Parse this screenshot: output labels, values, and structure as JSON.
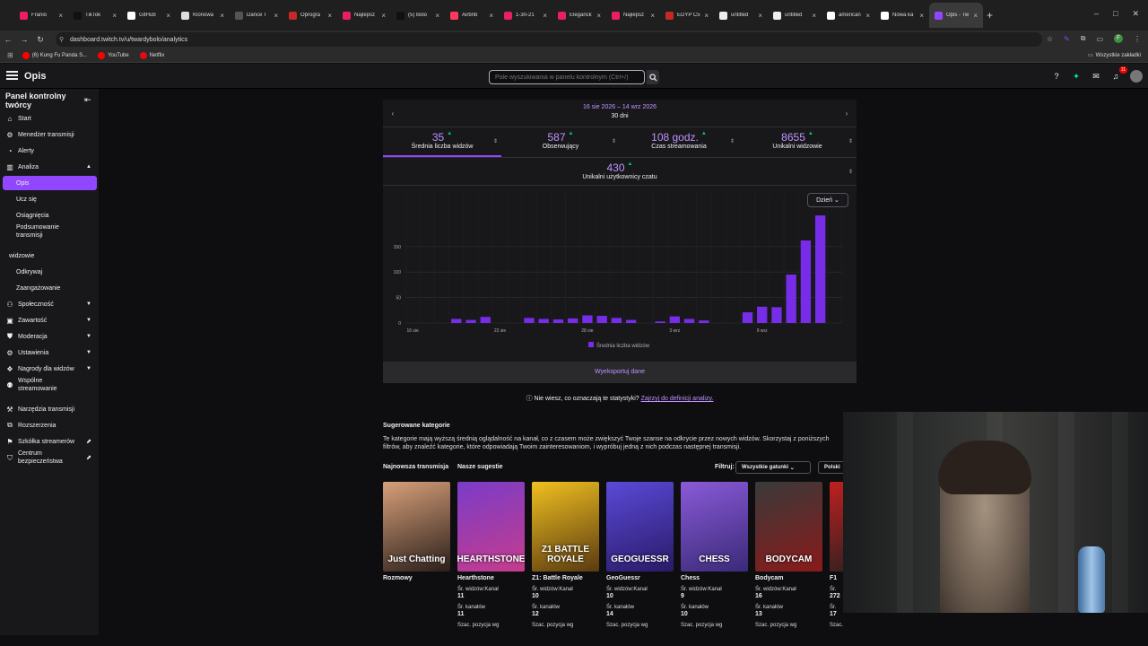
{
  "browser": {
    "tabs": [
      {
        "label": "Franio",
        "color": "#e91e63"
      },
      {
        "label": "TikTok",
        "color": "#111111"
      },
      {
        "label": "GitHub",
        "color": "#ffffff"
      },
      {
        "label": "Klonowa",
        "color": "#dddddd"
      },
      {
        "label": "Dance T",
        "color": "#555555"
      },
      {
        "label": "Oprogra",
        "color": "#c62828"
      },
      {
        "label": "Najlepsz",
        "color": "#e91e63"
      },
      {
        "label": "(5) Bolo",
        "color": "#111111"
      },
      {
        "label": "Airbnb",
        "color": "#ff385c"
      },
      {
        "label": "1-30-21",
        "color": "#e91e63"
      },
      {
        "label": "Eleganck",
        "color": "#e91e63"
      },
      {
        "label": "Najlepsz",
        "color": "#e91e63"
      },
      {
        "label": "EDYP C5",
        "color": "#c62828"
      },
      {
        "label": "untitled",
        "color": "#eeeeee"
      },
      {
        "label": "untitled",
        "color": "#eeeeee"
      },
      {
        "label": "american",
        "color": "#ffffff"
      },
      {
        "label": "Nowa ka",
        "color": "#ffffff"
      },
      {
        "label": "Opis - Tw",
        "color": "#9147ff",
        "active": true
      }
    ],
    "url": "dashboard.twitch.tv/u/twardybolo/analytics",
    "bookmarks": [
      {
        "label": "(6) Kung Fu Panda S...",
        "color": "#ff0000"
      },
      {
        "label": "YouTube",
        "color": "#ff0000"
      },
      {
        "label": "Netflix",
        "color": "#e50914"
      }
    ],
    "bookmarks_right": "Wszystkie zakładki",
    "profile_letter": "F"
  },
  "topnav": {
    "title": "Opis",
    "search_placeholder": "Pole wyszukiwania w panelu kontrolnym (Ctrl+/)",
    "notif_count": "11"
  },
  "sidebar": {
    "title": "Panel kontrolny twórcy",
    "items": [
      {
        "label": "Start",
        "icon": "⌂"
      },
      {
        "label": "Menedżer transmisji",
        "icon": "⚙"
      },
      {
        "label": "Alerty",
        "icon": "◔"
      },
      {
        "label": "Analiza",
        "icon": "▥",
        "chev": "▲"
      },
      {
        "label": "Opis"
      },
      {
        "label": "Ucz się"
      },
      {
        "label": "Osiągnięcia"
      },
      {
        "label": "Podsumowanie transmisji"
      },
      {
        "label": "widzowie"
      },
      {
        "label": "Odkrywaj"
      },
      {
        "label": "Zaangażowanie"
      },
      {
        "label": "Społeczność",
        "icon": "⚇",
        "chev": "▼"
      },
      {
        "label": "Zawartość",
        "icon": "▣",
        "chev": "▼"
      },
      {
        "label": "Moderacja",
        "icon": "⛊",
        "chev": "▼"
      },
      {
        "label": "Ustawienia",
        "icon": "⚙",
        "chev": "▼"
      },
      {
        "label": "Nagrody dla widzów",
        "icon": "❖",
        "chev": "▼"
      },
      {
        "label": "Wspólne streamowanie",
        "icon": "⚉"
      },
      {
        "label": "Narzędzia transmisji",
        "icon": "⚒"
      },
      {
        "label": "Rozszerzenia",
        "icon": "⧉"
      },
      {
        "label": "Szkółka streamerów",
        "icon": "⚑",
        "ext": "⬈"
      },
      {
        "label": "Centrum bezpieczeństwa",
        "icon": "⛉",
        "ext": "⬈"
      }
    ]
  },
  "analytics": {
    "date_range": "16 sie 2026 – 14 wrz 2026",
    "days": "30 dni",
    "stats": [
      {
        "value": "35",
        "label": "Średnia liczba widzów"
      },
      {
        "value": "587",
        "label": "Obserwujący"
      },
      {
        "value": "108 godz.",
        "label": "Czas streamowania"
      },
      {
        "value": "8655",
        "label": "Unikalni widzowie"
      }
    ],
    "stat2": {
      "value": "430",
      "label": "Unikalni użytkownicy czatu"
    },
    "granularity": "Dzień",
    "export": "Wyeksportuj dane",
    "help_text": "Nie wiesz, co oznaczają te statystyki?",
    "help_link": "Zajrzyj do definicji analizy."
  },
  "chart_data": {
    "type": "bar",
    "categories": [
      "16 sie",
      "17 sie",
      "18 sie",
      "19 sie",
      "20 sie",
      "21 sie",
      "22 sie",
      "23 sie",
      "24 sie",
      "25 sie",
      "26 sie",
      "27 sie",
      "28 sie",
      "29 sie",
      "30 sie",
      "31 sie",
      "1 wrz",
      "2 wrz",
      "3 wrz",
      "4 wrz",
      "5 wrz",
      "6 wrz",
      "7 wrz",
      "8 wrz",
      "9 wrz",
      "10 wrz",
      "11 wrz",
      "12 wrz",
      "13 wrz",
      "14 wrz"
    ],
    "tick_labels": [
      {
        "index": 0,
        "label": "16 sie"
      },
      {
        "index": 6,
        "label": "22 sie"
      },
      {
        "index": 12,
        "label": "28 sie"
      },
      {
        "index": 18,
        "label": "3 wrz"
      },
      {
        "index": 24,
        "label": "9 wrz"
      }
    ],
    "series": [
      {
        "name": "Średnia liczba widzów",
        "values": [
          0,
          0,
          0,
          8,
          6,
          12,
          0,
          0,
          10,
          8,
          7,
          9,
          15,
          14,
          10,
          6,
          0,
          3,
          13,
          8,
          5,
          0,
          0,
          21,
          32,
          31,
          95,
          162,
          211,
          0
        ]
      }
    ],
    "ylim": [
      0,
      150
    ],
    "yticks": [
      0,
      50,
      100,
      150
    ],
    "ylim_max": 220,
    "color": "#772ce8",
    "legend": "bottom"
  },
  "suggested": {
    "title": "Sugerowane kategorie",
    "description": "Te kategorie mają wyższą średnią oglądalność na kanał, co z czasem może zwiększyć Twoje szanse na odkrycie przez nowych widzów. Skorzystaj z poniższych filtrów, aby znaleźć kategorie, które odpowiadają Twoim zainteresowaniom, i wypróbuj jedną z nich podczas następnej transmisji.",
    "tab_latest": "Najnowsza transmisja",
    "tab_ours": "Nasze sugestie",
    "filter_label": "Filtruj:",
    "filter_value": "Wszystkie gatunki",
    "lang_value": "Polski",
    "cards": [
      {
        "name": "Rozmowy",
        "art": "Just Chatting",
        "c1": "#d8a07a",
        "c2": "#2a1f1a"
      },
      {
        "name": "Hearthstone",
        "art": "HEARTHSTONE",
        "c1": "#7a3cc8",
        "c2": "#c63c8c",
        "m1l": "Śr. widzów:Kanał",
        "m1v": "11",
        "m2l": "Śr. kanałów",
        "m2v": "11",
        "m3l": "Szac. pozycja wg"
      },
      {
        "name": "Z1: Battle Royale",
        "art": "Z1 BATTLE ROYALE",
        "c1": "#f0c020",
        "c2": "#5a3a10",
        "m1l": "Śr. widzów:Kanał",
        "m1v": "10",
        "m2l": "Śr. kanałów",
        "m2v": "12",
        "m3l": "Szac. pozycja wg"
      },
      {
        "name": "GeoGuessr",
        "art": "GEOGUESSR",
        "c1": "#5a4ad8",
        "c2": "#2a1a68",
        "m1l": "Śr. widzów:Kanał",
        "m1v": "10",
        "m2l": "Śr. kanałów",
        "m2v": "14",
        "m3l": "Szac. pozycja wg"
      },
      {
        "name": "Chess",
        "art": "CHESS",
        "c1": "#8a5ad8",
        "c2": "#3a2a78",
        "m1l": "Śr. widzów:Kanał",
        "m1v": "9",
        "m2l": "Śr. kanałów",
        "m2v": "10",
        "m3l": "Szac. pozycja wg"
      },
      {
        "name": "Bodycam",
        "art": "BODYCAM",
        "c1": "#3a3a3a",
        "c2": "#8a1a1a",
        "m1l": "Śr. widzów:Kanał",
        "m1v": "16",
        "m2l": "Śr. kanałów",
        "m2v": "13",
        "m3l": "Szac. pozycja wg"
      },
      {
        "name": "F1",
        "art": "",
        "c1": "#c02020",
        "c2": "#202020",
        "m1l": "Śr.",
        "m1v": "272",
        "m2l": "Śr.",
        "m2v": "17",
        "m3l": "Szac."
      }
    ]
  }
}
